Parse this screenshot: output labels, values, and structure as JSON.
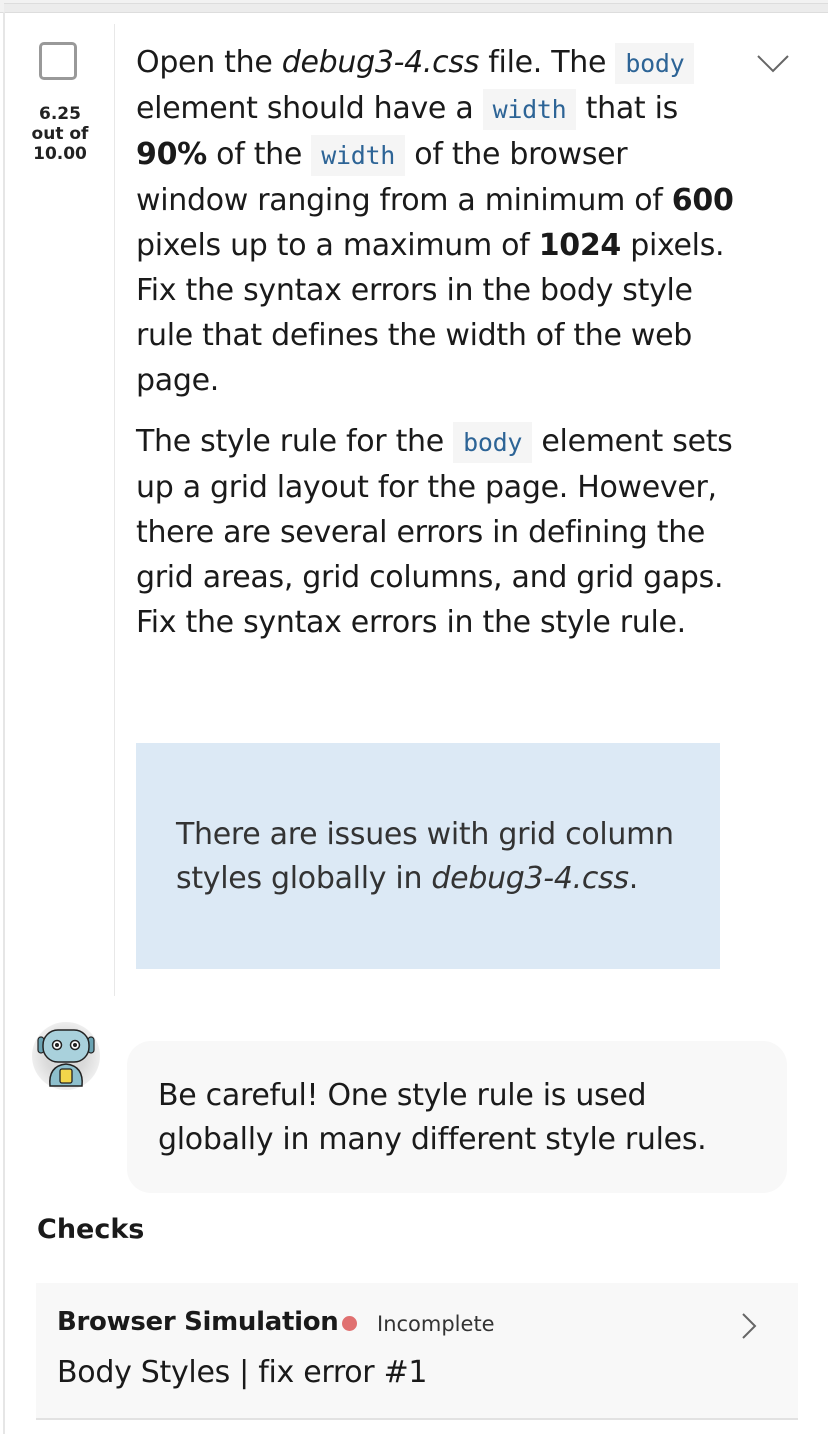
{
  "task": {
    "score": "6.25",
    "score_out_of_label": "out of",
    "score_max": "10.00",
    "instructions": {
      "p1": {
        "t1": "Open the ",
        "file": "debug3-4.css",
        "t2": " file. The ",
        "code1": "body",
        "t3": " element should have a ",
        "code2": "width",
        "t4": " that is ",
        "bold1": "90%",
        "t5": " of the ",
        "code3": "width",
        "t6": " of the browser window ranging from a minimum of ",
        "bold2": "600",
        "t7": " pixels up to a maximum of ",
        "bold3": "1024",
        "t8": " pixels. Fix the syntax errors in the body style rule that defines the width of the web page."
      },
      "p2": {
        "t1": "The style rule for the ",
        "code1": "body",
        "t2": " element sets up a grid layout for the page. However, there are several errors in defining the grid areas, grid columns, and grid gaps. Fix the syntax errors in the style rule."
      }
    },
    "hint": {
      "t1": "There are issues with grid column styles globally in ",
      "file": "debug3-4.css",
      "t2": "."
    }
  },
  "assistant": {
    "avatar_icon": "robot-icon",
    "message": "Be careful! One style rule is used globally in many different style rules."
  },
  "checks": {
    "title": "Checks",
    "items": [
      {
        "type": "Browser Simulation",
        "status": "Incomplete",
        "status_color": "#e07070",
        "name": "Body Styles | fix error #1"
      }
    ]
  }
}
